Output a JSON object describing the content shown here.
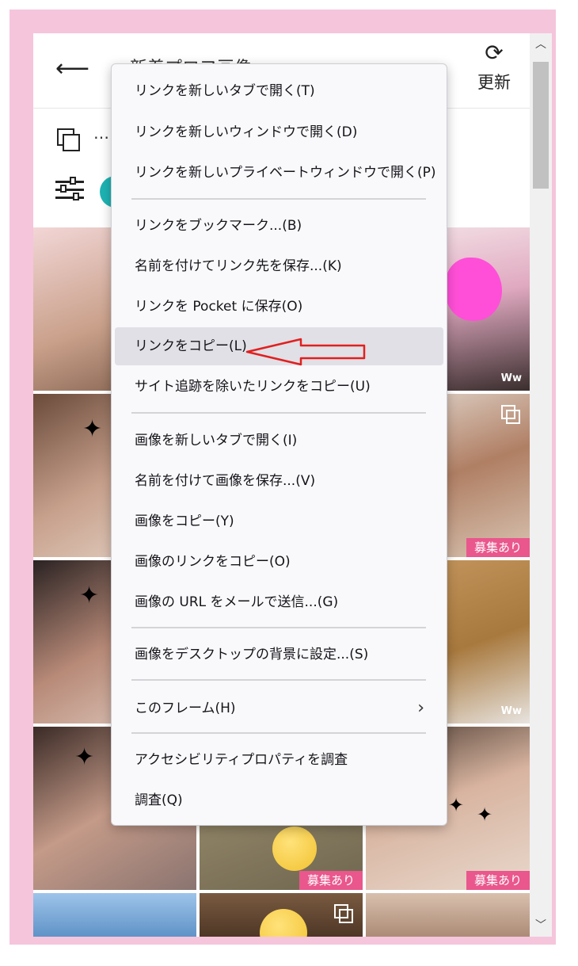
{
  "header": {
    "back_icon": "back-arrow-icon",
    "title": "新着プロフ画像",
    "refresh_label": "更新"
  },
  "toolbar": {
    "ellipsis": "…"
  },
  "tiles": {
    "badge_text": "募集あり",
    "ww_text": "Ww"
  },
  "menu": {
    "items": [
      {
        "label": "リンクを新しいタブで開く(T)"
      },
      {
        "label": "リンクを新しいウィンドウで開く(D)"
      },
      {
        "label": "リンクを新しいプライベートウィンドウで開く(P)"
      },
      {
        "label": "リンクをブックマーク...(B)"
      },
      {
        "label": "名前を付けてリンク先を保存...(K)"
      },
      {
        "label": "リンクを Pocket に保存(O)"
      },
      {
        "label": "リンクをコピー(L)"
      },
      {
        "label": "サイト追跡を除いたリンクをコピー(U)"
      },
      {
        "label": "画像を新しいタブで開く(I)"
      },
      {
        "label": "名前を付けて画像を保存...(V)"
      },
      {
        "label": "画像をコピー(Y)"
      },
      {
        "label": "画像のリンクをコピー(O)"
      },
      {
        "label": "画像の URL をメールで送信...(G)"
      },
      {
        "label": "画像をデスクトップの背景に設定...(S)"
      },
      {
        "label": "このフレーム(H)"
      },
      {
        "label": "アクセシビリティプロパティを調査"
      },
      {
        "label": "調査(Q)"
      }
    ],
    "highlighted": "リンクをコピー(L)",
    "submenu_icon": "chevron-right-icon"
  },
  "colors": {
    "frame": "#f5c5dc",
    "badge": "#e9578c",
    "annotation_arrow": "#e02020",
    "highlight": "#e0e0e6"
  }
}
